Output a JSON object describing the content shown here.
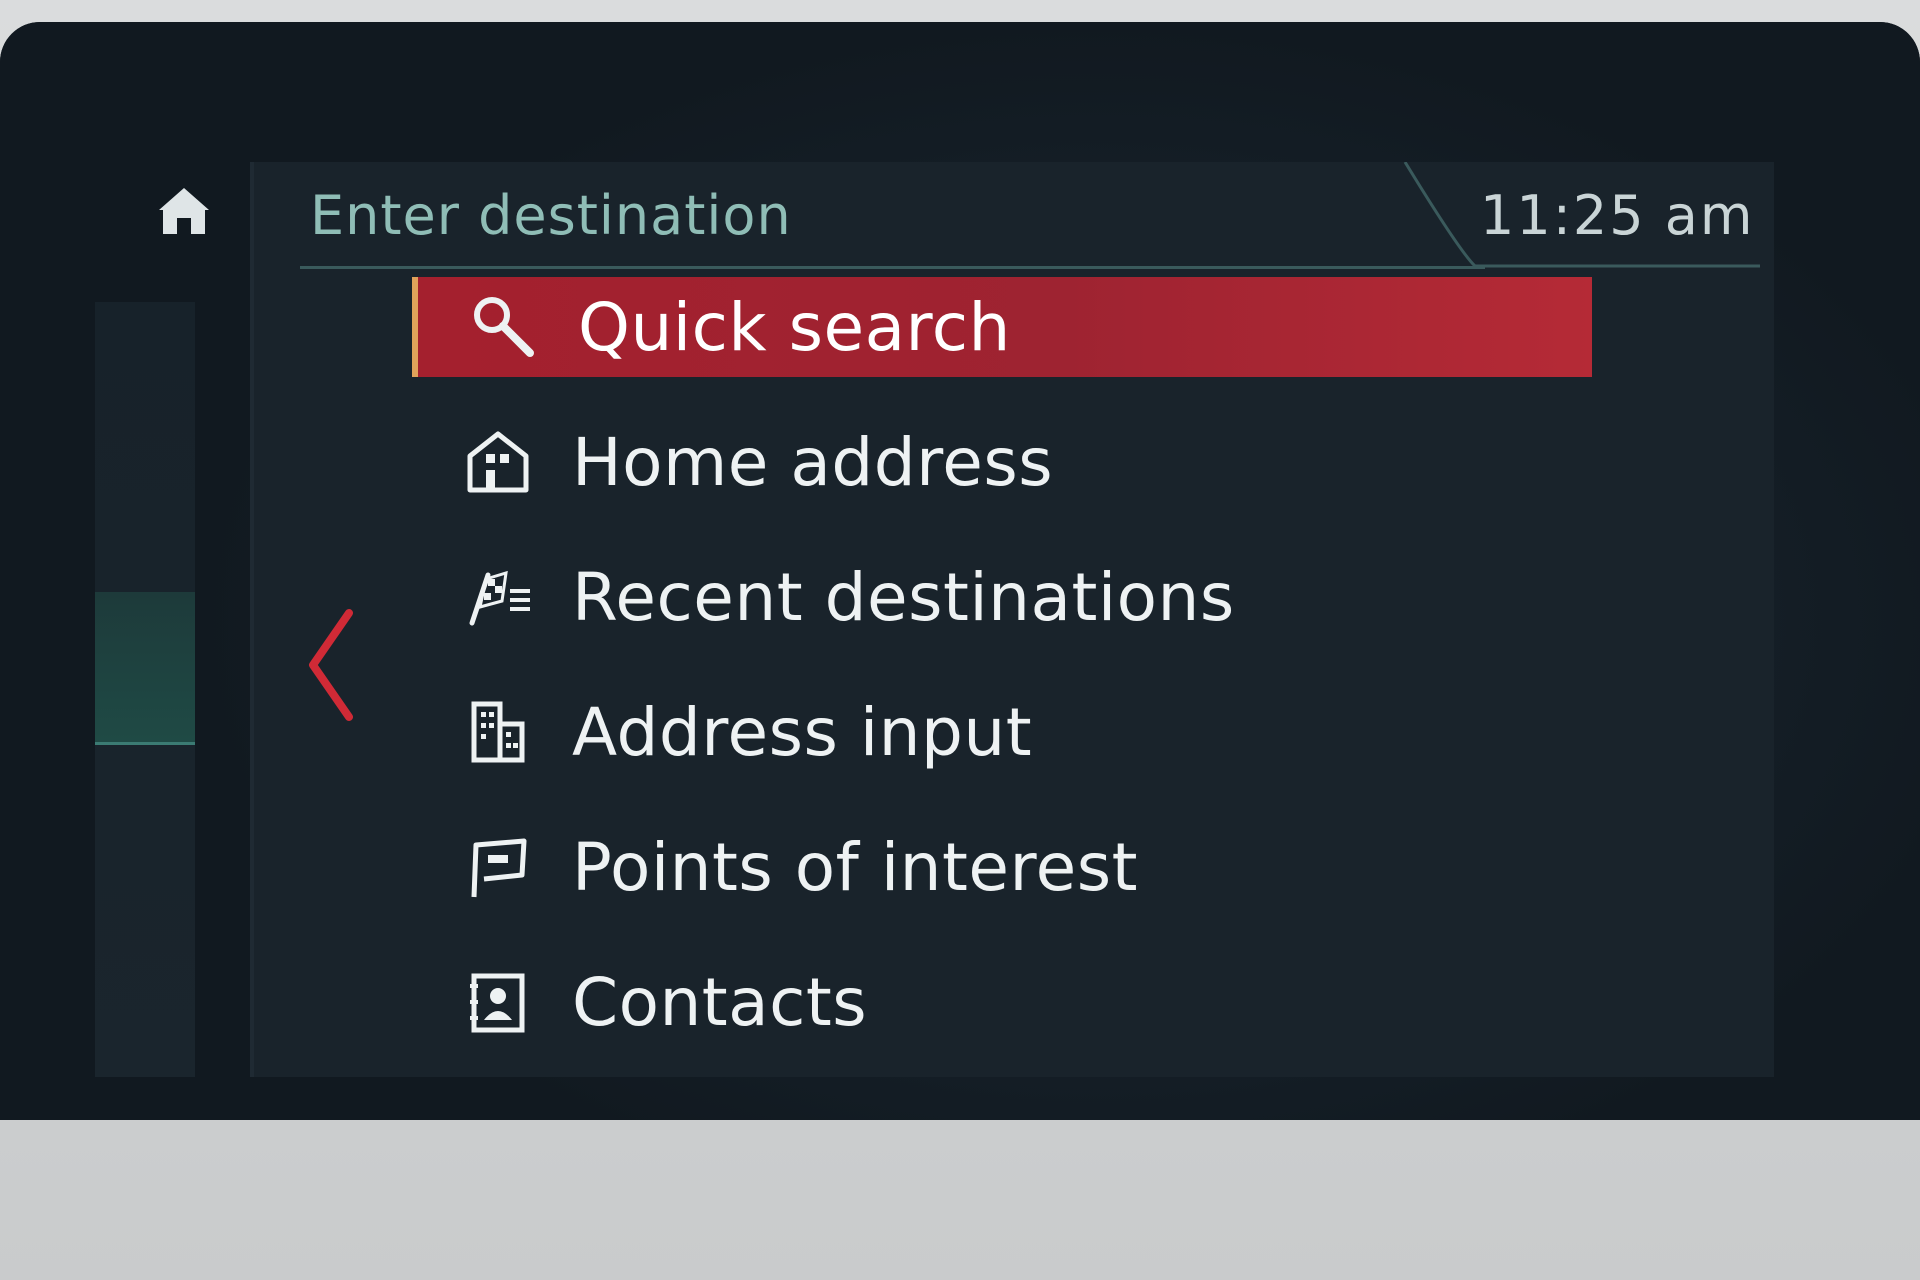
{
  "header": {
    "title": "Enter destination",
    "clock": "11:25  am",
    "home_icon": "home-icon"
  },
  "nav": {
    "back_icon": "chevron-left-icon"
  },
  "menu": {
    "selected_index": 0,
    "items": [
      {
        "label": "Quick search",
        "icon": "search-icon"
      },
      {
        "label": "Home address",
        "icon": "house-icon"
      },
      {
        "label": "Recent destinations",
        "icon": "checkered-flag-list-icon"
      },
      {
        "label": "Address input",
        "icon": "building-icon"
      },
      {
        "label": "Points of interest",
        "icon": "poi-flag-icon"
      },
      {
        "label": "Contacts",
        "icon": "contact-card-icon"
      }
    ]
  },
  "colors": {
    "selected_bg": "#a4202e",
    "header_text": "#8fbdb6",
    "accent_arrow": "#d02a36"
  }
}
